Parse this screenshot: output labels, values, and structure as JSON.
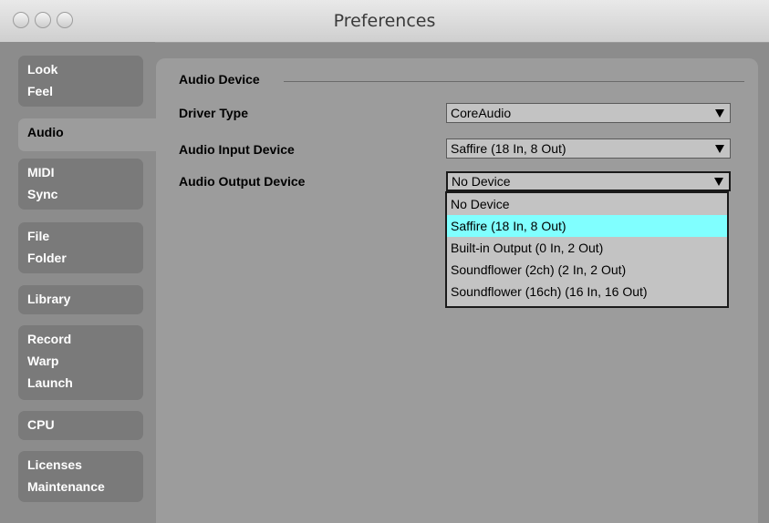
{
  "window": {
    "title": "Preferences"
  },
  "sidebar": {
    "tabs": [
      {
        "lines": [
          "Look",
          "Feel"
        ]
      },
      {
        "lines": [
          "Audio"
        ],
        "active": true
      },
      {
        "lines": [
          "MIDI",
          "Sync"
        ]
      },
      {
        "lines": [
          "File",
          "Folder"
        ]
      },
      {
        "lines": [
          "Library"
        ]
      },
      {
        "lines": [
          "Record",
          "Warp",
          "Launch"
        ]
      },
      {
        "lines": [
          "CPU"
        ]
      },
      {
        "lines": [
          "Licenses",
          "Maintenance"
        ]
      }
    ]
  },
  "audio_device": {
    "section_title": "Audio Device",
    "driver_type": {
      "label": "Driver Type",
      "value": "CoreAudio"
    },
    "input_device": {
      "label": "Audio Input Device",
      "value": "Saffire (18 In, 8 Out)"
    },
    "output_device": {
      "label": "Audio Output Device",
      "value": "No Device",
      "options": [
        "No Device",
        "Saffire (18 In, 8 Out)",
        "Built-in Output (0 In, 2 Out)",
        "Soundflower (2ch) (2 In, 2 Out)",
        "Soundflower (16ch) (16 In, 16 Out)"
      ],
      "highlighted_index": 1
    }
  },
  "colors": {
    "highlight": "#80ffff",
    "window_bg": "#8c8c8c",
    "panel_bg": "#9c9c9c"
  }
}
